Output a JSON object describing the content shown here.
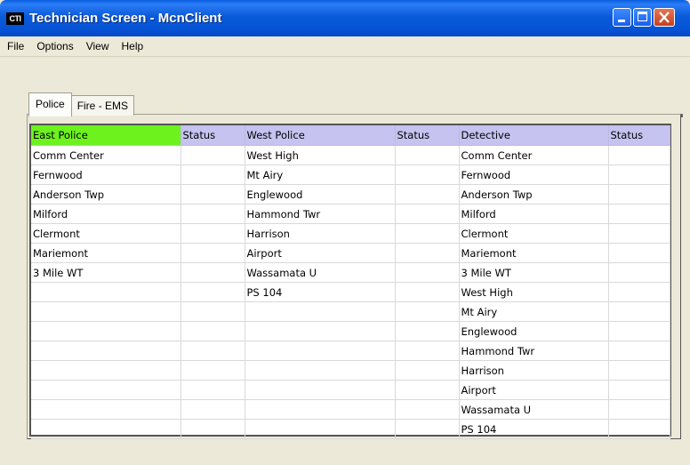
{
  "window": {
    "title": "Technician Screen - McnClient",
    "app_icon_label": "CTI",
    "controls": [
      "minimize-icon",
      "maximize-icon",
      "close-icon"
    ]
  },
  "menu": [
    "File",
    "Options",
    "View",
    "Help"
  ],
  "tabs": [
    {
      "label": "Police",
      "active": true
    },
    {
      "label": "Fire - EMS",
      "active": false
    }
  ],
  "grid": {
    "headers": [
      "East Police",
      "Status",
      "West Police",
      "Status",
      "Detective",
      "Status"
    ],
    "header_colors": {
      "highlight": "#6df21e",
      "default": "#c6c3f0"
    },
    "rows": [
      [
        "Comm Center",
        "",
        "West High",
        "",
        "Comm Center",
        ""
      ],
      [
        "Fernwood",
        "",
        "Mt Airy",
        "",
        "Fernwood",
        ""
      ],
      [
        "Anderson Twp",
        "",
        "Englewood",
        "",
        "Anderson Twp",
        ""
      ],
      [
        "Milford",
        "",
        "Hammond Twr",
        "",
        "Milford",
        ""
      ],
      [
        "Clermont",
        "",
        "Harrison",
        "",
        "Clermont",
        ""
      ],
      [
        "Mariemont",
        "",
        "Airport",
        "",
        "Mariemont",
        ""
      ],
      [
        "3 Mile WT",
        "",
        "Wassamata U",
        "",
        "3 Mile WT",
        ""
      ],
      [
        "",
        "",
        "PS 104",
        "",
        "West High",
        ""
      ],
      [
        "",
        "",
        "",
        "",
        "Mt Airy",
        ""
      ],
      [
        "",
        "",
        "",
        "",
        "Englewood",
        ""
      ],
      [
        "",
        "",
        "",
        "",
        "Hammond Twr",
        ""
      ],
      [
        "",
        "",
        "",
        "",
        "Harrison",
        ""
      ],
      [
        "",
        "",
        "",
        "",
        "Airport",
        ""
      ],
      [
        "",
        "",
        "",
        "",
        "Wassamata U",
        ""
      ],
      [
        "",
        "",
        "",
        "",
        "PS 104",
        ""
      ]
    ]
  }
}
